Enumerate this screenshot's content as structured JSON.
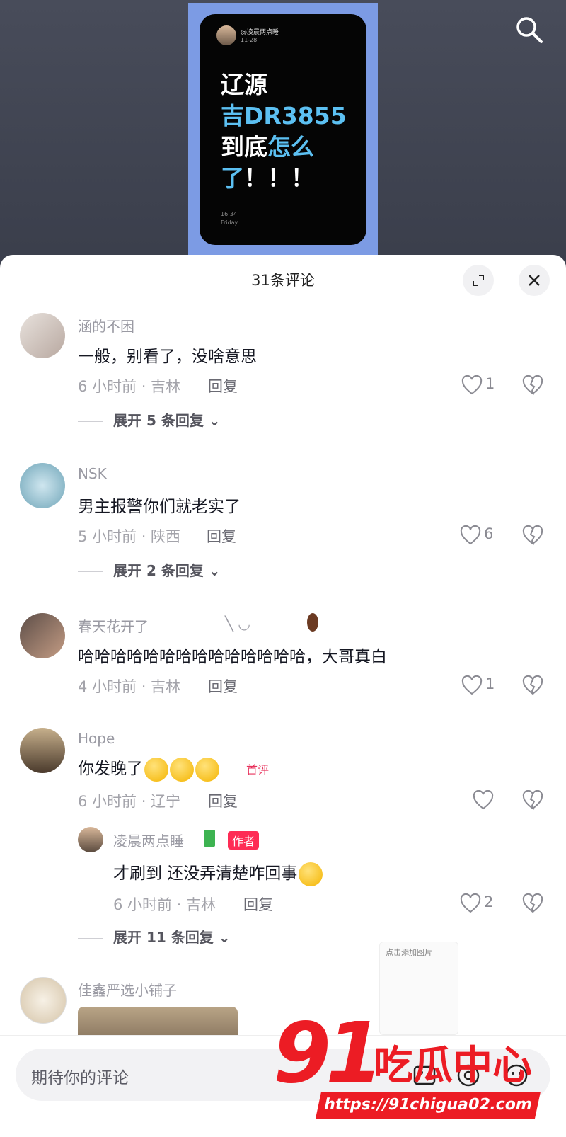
{
  "video": {
    "phone_user": "@凌晨两点睡",
    "phone_date": "11-28",
    "line1": "辽源",
    "line2": "吉DR3855",
    "line3a": "到底",
    "line3b": "怎么",
    "line4a": "了",
    "line4b": "！！！",
    "phone_time": "16:34",
    "phone_day": "Friday"
  },
  "sheet": {
    "title": "31条评论"
  },
  "comments": [
    {
      "user": "涵的不困",
      "text": "一般，别看了，没啥意思",
      "meta": "6 小时前 · 吉林",
      "reply": "回复",
      "likes": "1",
      "expand": "展开 5 条回复"
    },
    {
      "user": "NSK",
      "text": "男主报警你们就老实了",
      "meta": "5 小时前 · 陕西",
      "reply": "回复",
      "likes": "6",
      "expand": "展开 2 条回复"
    },
    {
      "user": "春天花开了",
      "user_suffix": "╲   ◡",
      "text": "哈哈哈哈哈哈哈哈哈哈哈哈哈哈，大哥真白",
      "meta": "4 小时前 · 吉林",
      "reply": "回复",
      "likes": "1"
    },
    {
      "user": "Hope",
      "text": "你发晚了",
      "badge": "首评",
      "meta": "6 小时前 · 辽宁",
      "reply": "回复",
      "likes": "",
      "sub": {
        "user": "凌晨两点睡",
        "badge": "作者",
        "text": "才刷到 还没弄清楚咋回事",
        "meta": "6 小时前 · 吉林",
        "reply": "回复",
        "likes": "2"
      },
      "expand": "展开 11 条回复"
    },
    {
      "user": "佳鑫严选小铺子"
    }
  ],
  "preview": {
    "label": "点击添加图片"
  },
  "input": {
    "placeholder": "期待你的评论"
  },
  "watermark": {
    "num": "91",
    "cn": "吃瓜中心",
    "url": "https://91chigua02.com"
  },
  "colors": {
    "accent": "#fe2c55",
    "watermark": "#ec1c24",
    "phone_blue": "#5cc0f2"
  }
}
